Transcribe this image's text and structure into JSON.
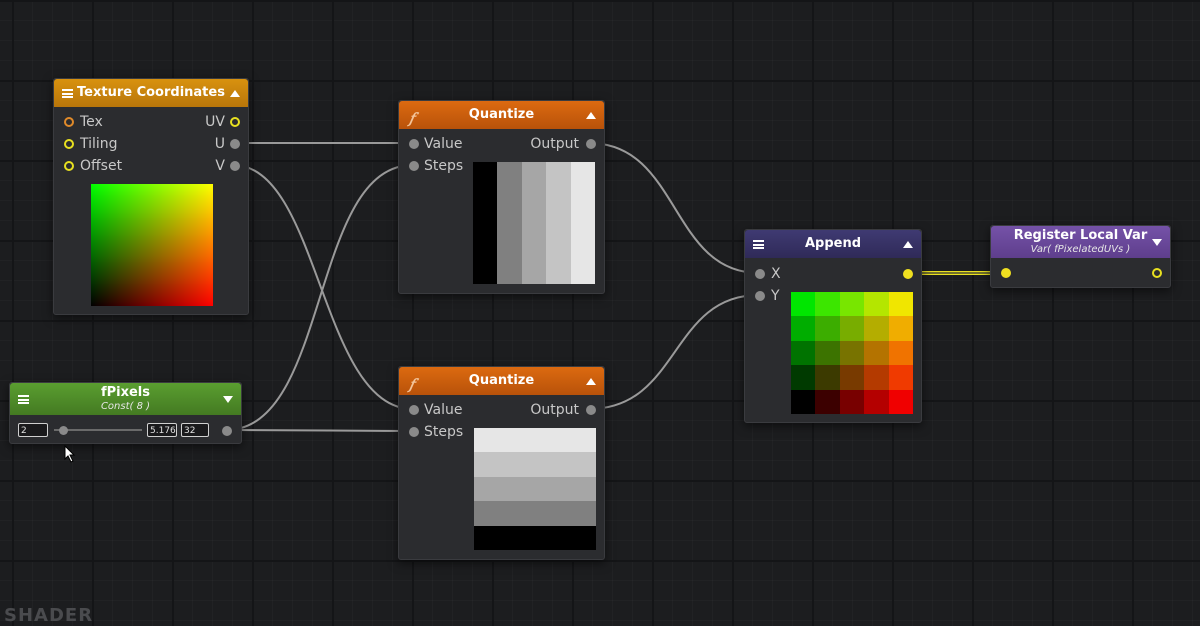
{
  "nodes": {
    "texcoords": {
      "title": "Texture Coordinates",
      "inputs": [
        "Tex",
        "Tiling",
        "Offset"
      ],
      "outputs": [
        "UV",
        "U",
        "V"
      ],
      "color": "#c8820e"
    },
    "quantize_top": {
      "title": "Quantize",
      "inputs": [
        "Value",
        "Steps"
      ],
      "output": "Output",
      "color": "#d0600a",
      "bands": [
        "#000000",
        "#808080",
        "#a6a6a6",
        "#c4c4c4",
        "#e6e6e6"
      ]
    },
    "quantize_bottom": {
      "title": "Quantize",
      "inputs": [
        "Value",
        "Steps"
      ],
      "output": "Output",
      "color": "#d0600a",
      "bands": [
        "#e6e6e6",
        "#c4c4c4",
        "#a6a6a6",
        "#808080",
        "#000000"
      ]
    },
    "fpixels": {
      "title": "fPixels",
      "subtitle": "Const( 8 )",
      "min": "2",
      "value": "5.176",
      "max": "32",
      "slider_fraction": 0.1,
      "color": "#4f8f2a"
    },
    "append": {
      "title": "Append",
      "inputs": [
        "X",
        "Y"
      ],
      "color": "#3a3466"
    },
    "register": {
      "title": "Register Local Var",
      "subtitle": "Var( fPixelatedUVs )",
      "color": "#6a4a9a"
    }
  },
  "watermark": "SHADER"
}
